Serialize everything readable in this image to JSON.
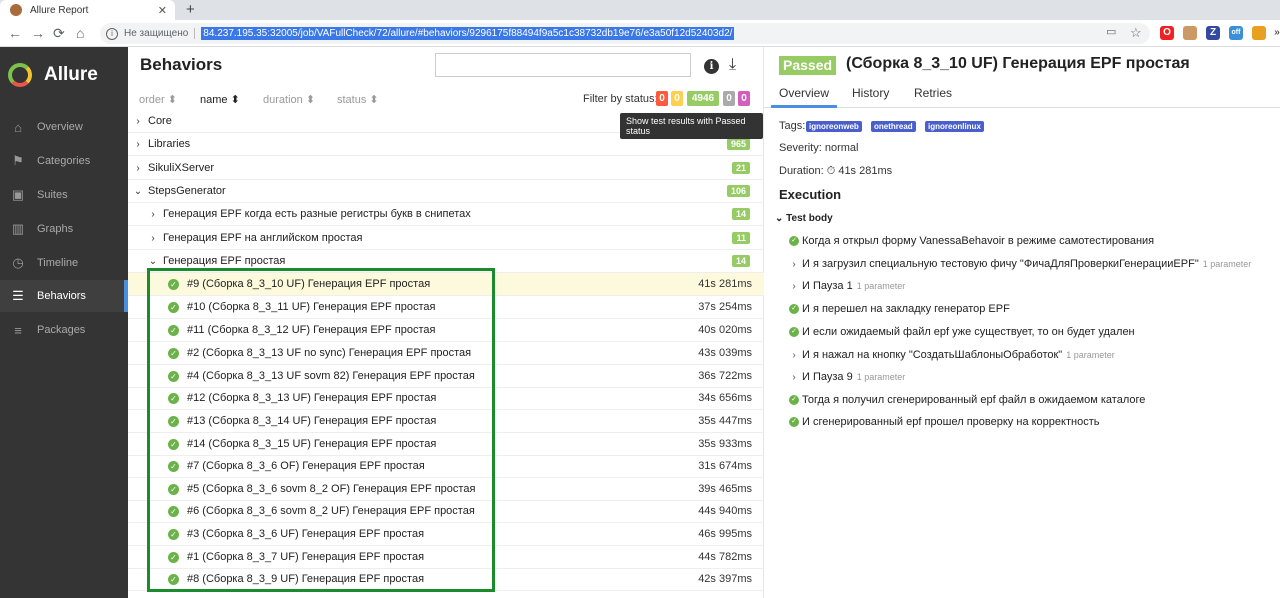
{
  "browser": {
    "tab_title": "Allure Report",
    "tab_close": "✕",
    "new_tab": "+",
    "back": "←",
    "forward": "→",
    "reload": "⟳",
    "home": "⌂",
    "info": "i",
    "security": "Не защищено",
    "url": "84.237.195.35:32005/job/VAFullCheck/72/allure/#behaviors/9296175f88494f9a5c1c38732db19e76/e3a50f12d52403d2/",
    "extensions": [
      "O",
      "Z",
      "off",
      "»"
    ]
  },
  "sidebar": {
    "logo": "Allure",
    "items": [
      {
        "label": "Overview",
        "icon": "home-icon"
      },
      {
        "label": "Categories",
        "icon": "flag-icon"
      },
      {
        "label": "Suites",
        "icon": "briefcase-icon"
      },
      {
        "label": "Graphs",
        "icon": "bar-chart-icon"
      },
      {
        "label": "Timeline",
        "icon": "clock-icon"
      },
      {
        "label": "Behaviors",
        "icon": "list-icon"
      },
      {
        "label": "Packages",
        "icon": "stack-icon"
      }
    ],
    "active": "Behaviors"
  },
  "behaviors": {
    "title": "Behaviors",
    "search_value": "",
    "sort_headers": [
      "order",
      "name",
      "duration",
      "status"
    ],
    "filter_label": "Filter by status:",
    "filter_badges": [
      {
        "value": "0",
        "color": "#fd5a3e"
      },
      {
        "value": "0",
        "color": "#ffd050"
      },
      {
        "value": "4946",
        "color": "#97cc64"
      },
      {
        "value": "0",
        "color": "#aaaaaa"
      },
      {
        "value": "0",
        "color": "#d35ebe"
      }
    ],
    "tooltip": "Show test results with Passed status",
    "groups": [
      {
        "name": "Core",
        "count": ""
      },
      {
        "name": "Libraries",
        "count": "965"
      },
      {
        "name": "SikuliXServer",
        "count": "21"
      },
      {
        "name": "StepsGenerator",
        "count": "106"
      }
    ],
    "subgroups": [
      {
        "name": "Генерация EPF когда есть разные регистры букв в снипетах",
        "count": "14"
      },
      {
        "name": "Генерация EPF на английском простая",
        "count": "11"
      },
      {
        "name": "Генерация EPF простая",
        "count": "14"
      }
    ],
    "tests": [
      {
        "name": "#9  (Сборка 8_3_10 UF) Генерация EPF простая",
        "duration": "41s 281ms"
      },
      {
        "name": "#10  (Сборка 8_3_11 UF) Генерация EPF простая",
        "duration": "37s 254ms"
      },
      {
        "name": "#11  (Сборка 8_3_12 UF) Генерация EPF простая",
        "duration": "40s 020ms"
      },
      {
        "name": "#2  (Сборка 8_3_13 UF no sync) Генерация EPF простая",
        "duration": "43s 039ms"
      },
      {
        "name": "#4  (Сборка 8_3_13 UF sovm 82) Генерация EPF простая",
        "duration": "36s 722ms"
      },
      {
        "name": "#12  (Сборка 8_3_13 UF) Генерация EPF простая",
        "duration": "34s 656ms"
      },
      {
        "name": "#13  (Сборка 8_3_14 UF) Генерация EPF простая",
        "duration": "35s 447ms"
      },
      {
        "name": "#14  (Сборка 8_3_15 UF) Генерация EPF простая",
        "duration": "35s 933ms"
      },
      {
        "name": "#7  (Сборка 8_3_6 OF) Генерация EPF простая",
        "duration": "31s 674ms"
      },
      {
        "name": "#5  (Сборка 8_3_6 sovm 8_2 OF) Генерация EPF простая",
        "duration": "39s 465ms"
      },
      {
        "name": "#6  (Сборка 8_3_6 sovm 8_2 UF) Генерация EPF простая",
        "duration": "44s 940ms"
      },
      {
        "name": "#3  (Сборка 8_3_6 UF) Генерация EPF простая",
        "duration": "46s 995ms"
      },
      {
        "name": "#1  (Сборка 8_3_7 UF) Генерация EPF простая",
        "duration": "44s 782ms"
      },
      {
        "name": "#8  (Сборка 8_3_9 UF) Генерация EPF простая",
        "duration": "42s 397ms"
      }
    ]
  },
  "detail": {
    "status": "Passed",
    "title": "(Сборка 8_3_10 UF) Генерация EPF простая",
    "tabs": [
      "Overview",
      "History",
      "Retries"
    ],
    "tags_label": "Tags:",
    "tags": [
      "ignoreonweb",
      "onethread",
      "ignoreonlinux"
    ],
    "severity": "Severity: normal",
    "duration": "Duration: ⏱ 41s 281ms",
    "execution": "Execution",
    "test_body": "Test body",
    "steps": [
      {
        "text": "Когда я открыл форму VanessaBehavoir в режиме самотестирования",
        "kind": "ok",
        "param": ""
      },
      {
        "text": "И я загрузил специальную тестовую фичу \"ФичаДляПроверкиГенерацииEPF\"",
        "kind": "expand",
        "param": "1 parameter"
      },
      {
        "text": "И Пауза 1",
        "kind": "expand",
        "param": "1 parameter"
      },
      {
        "text": "И я перешел на закладку генератор EPF",
        "kind": "ok",
        "param": ""
      },
      {
        "text": "И если ожидаемый файл epf уже существует, то он будет удален",
        "kind": "ok",
        "param": ""
      },
      {
        "text": "И я нажал на кнопку \"СоздатьШаблоныОбработок\"",
        "kind": "expand",
        "param": "1 parameter"
      },
      {
        "text": "И Пауза 9",
        "kind": "expand",
        "param": "1 parameter"
      },
      {
        "text": "Тогда я получил сгенерированный epf файл в ожидаемом каталоге",
        "kind": "ok",
        "param": ""
      },
      {
        "text": "И сгенерированный epf прошел проверку на корректность",
        "kind": "ok",
        "param": ""
      }
    ]
  }
}
